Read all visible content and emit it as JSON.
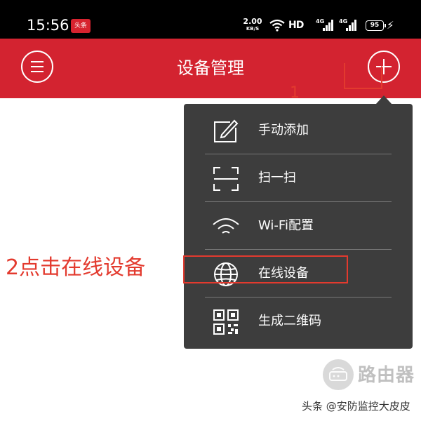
{
  "status_bar": {
    "time": "15:56",
    "notification_icon_text": "头条",
    "net_speed_value": "2.00",
    "net_speed_unit": "KB/S",
    "hd_label": "HD",
    "sim1_label": "4G",
    "sim2_label": "4G",
    "battery_level": "95",
    "icons": [
      "news-app-icon",
      "wifi-icon",
      "signal-icon",
      "signal-icon",
      "battery-icon",
      "charging-icon"
    ]
  },
  "header": {
    "title": "设备管理",
    "left_icon": "menu-icon",
    "right_icon": "plus-icon",
    "background_color": "#d32330"
  },
  "popup_menu": {
    "background_color": "#3d3d3d",
    "items": [
      {
        "label": "手动添加",
        "icon": "edit-icon"
      },
      {
        "label": "扫一扫",
        "icon": "scan-icon"
      },
      {
        "label": "Wi-Fi配置",
        "icon": "wifi-icon"
      },
      {
        "label": "在线设备",
        "icon": "globe-icon"
      },
      {
        "label": "生成二维码",
        "icon": "qr-code-icon"
      }
    ]
  },
  "annotations": {
    "step1": "1",
    "step2": "2点击在线设备",
    "color": "#e33a2e"
  },
  "watermark": {
    "logo_text": "路由器",
    "text": "头条 @安防监控大皮皮"
  }
}
